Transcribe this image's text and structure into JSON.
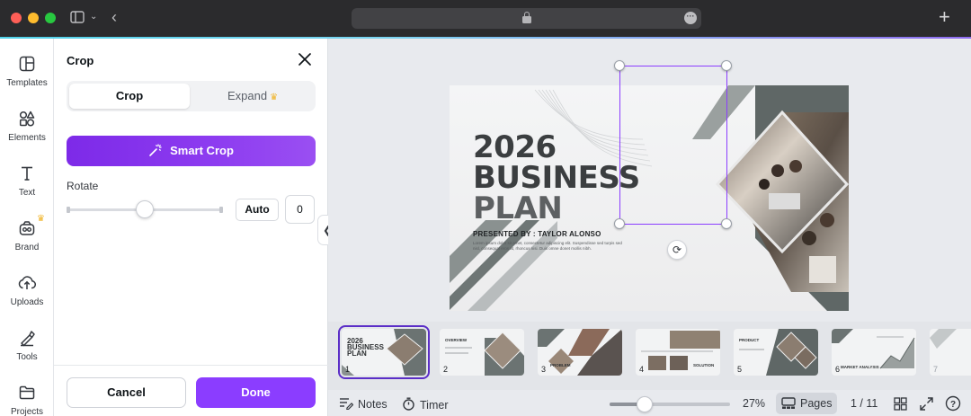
{
  "rail": {
    "items": [
      {
        "label": "Templates",
        "icon": "templates-icon"
      },
      {
        "label": "Elements",
        "icon": "elements-icon"
      },
      {
        "label": "Text",
        "icon": "text-icon"
      },
      {
        "label": "Brand",
        "icon": "brand-icon"
      },
      {
        "label": "Uploads",
        "icon": "uploads-icon"
      },
      {
        "label": "Tools",
        "icon": "tools-icon"
      },
      {
        "label": "Projects",
        "icon": "projects-icon"
      }
    ]
  },
  "panel": {
    "title": "Crop",
    "tabs": {
      "crop": "Crop",
      "expand": "Expand"
    },
    "smart_crop": "Smart Crop",
    "rotate_label": "Rotate",
    "rotate_auto": "Auto",
    "rotate_value": "0",
    "cancel": "Cancel",
    "done": "Done"
  },
  "slide": {
    "title_line1": "2026",
    "title_line2": "BUSINESS",
    "title_line3": "PLAN",
    "presented": "PRESENTED BY : TAYLOR ALONSO",
    "lorem": "Lorem ipsum dolor sit amet, consectetur adipiscing elit. Suspendisse sed turpis sed nisl, consequat eros at, rhoncus nisi. Duis omne donet mollis nibh."
  },
  "thumbs": [
    {
      "num": "1",
      "label": "2026 BUSINESS PLAN"
    },
    {
      "num": "2",
      "label": "OVERVIEW"
    },
    {
      "num": "3",
      "label": "PROBLEM"
    },
    {
      "num": "4",
      "label": "SOLUTION"
    },
    {
      "num": "5",
      "label": "PRODUCT"
    },
    {
      "num": "6",
      "label": "MARKET ANALYSIS"
    },
    {
      "num": "7",
      "label": ""
    }
  ],
  "bottom": {
    "notes": "Notes",
    "timer": "Timer",
    "zoom": "27%",
    "pages": "Pages",
    "page_count": "1 / 11"
  },
  "colors": {
    "accent": "#8b3dff",
    "smart_crop_gradient_start": "#7d2ae8",
    "crown": "#f0b429"
  }
}
